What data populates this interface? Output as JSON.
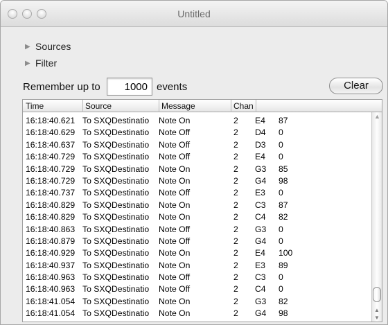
{
  "window": {
    "title": "Untitled"
  },
  "disclosures": {
    "sources": "Sources",
    "filter": "Filter"
  },
  "controls": {
    "remember_label": "Remember up to",
    "count_value": "1000",
    "events_label": "events",
    "clear_label": "Clear"
  },
  "table": {
    "headers": [
      "Time",
      "Source",
      "Message",
      "Chan"
    ],
    "rows": [
      [
        "16:18:40.621",
        "To SXQDestinatio",
        "Note On",
        "2",
        "E4",
        "87"
      ],
      [
        "16:18:40.629",
        "To SXQDestinatio",
        "Note Off",
        "2",
        "D4",
        "0"
      ],
      [
        "16:18:40.637",
        "To SXQDestinatio",
        "Note Off",
        "2",
        "D3",
        "0"
      ],
      [
        "16:18:40.729",
        "To SXQDestinatio",
        "Note Off",
        "2",
        "E4",
        "0"
      ],
      [
        "16:18:40.729",
        "To SXQDestinatio",
        "Note On",
        "2",
        "G3",
        "85"
      ],
      [
        "16:18:40.729",
        "To SXQDestinatio",
        "Note On",
        "2",
        "G4",
        "98"
      ],
      [
        "16:18:40.737",
        "To SXQDestinatio",
        "Note Off",
        "2",
        "E3",
        "0"
      ],
      [
        "16:18:40.829",
        "To SXQDestinatio",
        "Note On",
        "2",
        "C3",
        "87"
      ],
      [
        "16:18:40.829",
        "To SXQDestinatio",
        "Note On",
        "2",
        "C4",
        "82"
      ],
      [
        "16:18:40.863",
        "To SXQDestinatio",
        "Note Off",
        "2",
        "G3",
        "0"
      ],
      [
        "16:18:40.879",
        "To SXQDestinatio",
        "Note Off",
        "2",
        "G4",
        "0"
      ],
      [
        "16:18:40.929",
        "To SXQDestinatio",
        "Note On",
        "2",
        "E4",
        "100"
      ],
      [
        "16:18:40.937",
        "To SXQDestinatio",
        "Note On",
        "2",
        "E3",
        "89"
      ],
      [
        "16:18:40.963",
        "To SXQDestinatio",
        "Note Off",
        "2",
        "C3",
        "0"
      ],
      [
        "16:18:40.963",
        "To SXQDestinatio",
        "Note Off",
        "2",
        "C4",
        "0"
      ],
      [
        "16:18:41.054",
        "To SXQDestinatio",
        "Note On",
        "2",
        "G3",
        "82"
      ],
      [
        "16:18:41.054",
        "To SXQDestinatio",
        "Note On",
        "2",
        "G4",
        "98"
      ]
    ]
  },
  "icons": {
    "disclosure": "disclosure-triangle-icon",
    "window_buttons": [
      "close-icon",
      "minimize-icon",
      "zoom-icon"
    ]
  }
}
